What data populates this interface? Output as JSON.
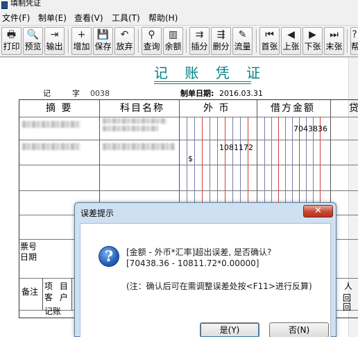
{
  "window": {
    "title": "填制凭证"
  },
  "menu": [
    "文件(F)",
    "制单(E)",
    "查看(V)",
    "工具(T)",
    "帮助(H)"
  ],
  "toolbar": [
    {
      "label": "打印",
      "icon": "printer-icon",
      "glyph": "🖶"
    },
    {
      "label": "预览",
      "icon": "preview-icon",
      "glyph": "🔍"
    },
    {
      "label": "输出",
      "icon": "export-icon",
      "glyph": "⇥"
    },
    {
      "label": "增加",
      "icon": "add-icon",
      "glyph": "+"
    },
    {
      "label": "保存",
      "icon": "save-icon",
      "glyph": "💾"
    },
    {
      "label": "放弃",
      "icon": "undo-icon",
      "glyph": "↶"
    },
    {
      "label": "查询",
      "icon": "binoculars-icon",
      "glyph": "⚲"
    },
    {
      "label": "余额",
      "icon": "bar-chart-icon",
      "glyph": "▥"
    },
    {
      "label": "插分",
      "icon": "insert-row-icon",
      "glyph": "⇉"
    },
    {
      "label": "删分",
      "icon": "delete-row-icon",
      "glyph": "⇶"
    },
    {
      "label": "流量",
      "icon": "edit-pen-icon",
      "glyph": "✎"
    },
    {
      "label": "首张",
      "icon": "first-icon",
      "glyph": "⏮"
    },
    {
      "label": "上张",
      "icon": "prev-icon",
      "glyph": "◀"
    },
    {
      "label": "下张",
      "icon": "next-icon",
      "glyph": "▶"
    },
    {
      "label": "末张",
      "icon": "last-icon",
      "glyph": "⏭"
    },
    {
      "label": "帮",
      "icon": "help-icon",
      "glyph": "?"
    }
  ],
  "voucher": {
    "title": "记 账 凭 证",
    "type_label": "记",
    "number_label": "字",
    "number": "0038",
    "date_label": "制单日期:",
    "date": "2016.03.31",
    "columns": [
      "摘 要",
      "科目名称",
      "外 币",
      "借方金额",
      "贷"
    ],
    "row1_debit": "7043836",
    "row2_foreign": "1081172",
    "row2_currency": "$",
    "ticket_label": "票号",
    "date_row_label": "日期",
    "remark_label": "备注",
    "project_label": "项 目",
    "customer_label": "客 户",
    "bookkeep_label": "记账",
    "right_labels": [
      "人",
      "回",
      "回"
    ]
  },
  "dialog": {
    "title": "误差提示",
    "close": "✕",
    "line1": "[金额 - 外币*汇率]超出误差, 是否确认?",
    "line2": "[70438.36 - 10811.72*0.00000]",
    "line3": "(注：确认后可在需调整误差处按<F11>进行反算)",
    "yes": "是(Y)",
    "no": "否(N)"
  }
}
